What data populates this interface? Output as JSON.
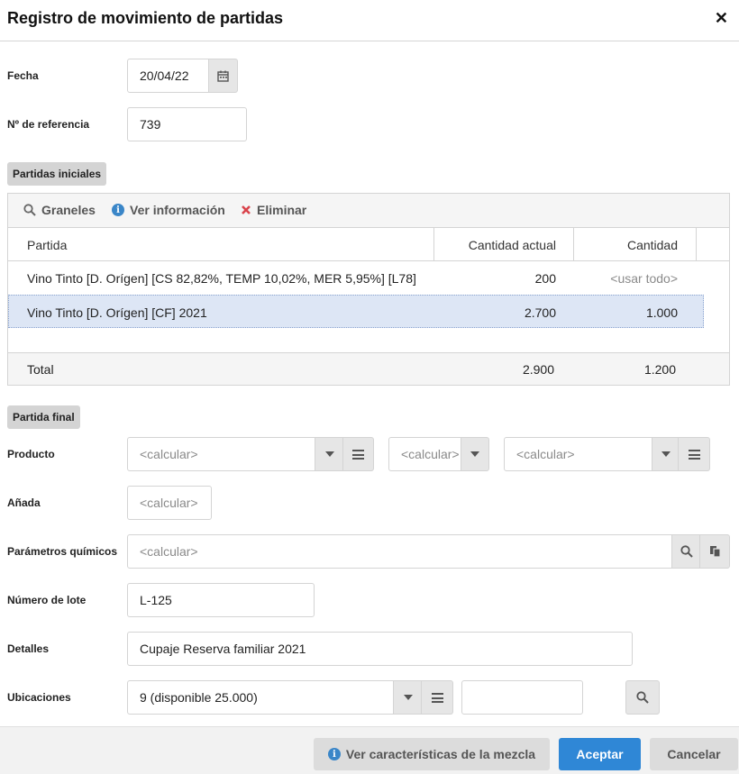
{
  "dialog": {
    "title": "Registro de movimiento de partidas",
    "close_symbol": "✕"
  },
  "fields": {
    "fecha": {
      "label": "Fecha",
      "value": "20/04/22"
    },
    "referencia": {
      "label": "Nº de referencia",
      "value": "739"
    }
  },
  "partidas_iniciales": {
    "section_label": "Partidas iniciales",
    "toolbar": [
      {
        "label": "Graneles",
        "icon": "search-icon"
      },
      {
        "label": "Ver información",
        "icon": "info-icon"
      },
      {
        "label": "Eliminar",
        "icon": "delete-x-icon"
      }
    ],
    "columns": [
      "Partida",
      "Cantidad actual",
      "Cantidad"
    ],
    "rows": [
      {
        "partida": "Vino Tinto [D. Orígen] [CS 82,82%, TEMP 10,02%, MER 5,95%] [L78]",
        "actual": "200",
        "cantidad": "<usar todo>",
        "selected": false
      },
      {
        "partida": "Vino Tinto [D. Orígen] [CF] 2021",
        "actual": "2.700",
        "cantidad": "1.000",
        "selected": true
      }
    ],
    "total": {
      "label": "Total",
      "actual": "2.900",
      "cantidad": "1.200"
    }
  },
  "partida_final": {
    "section_label": "Partida final",
    "producto": {
      "label": "Producto",
      "field1": "<calcular>",
      "field2": "<calcular>",
      "field3": "<calcular>"
    },
    "anada": {
      "label": "Añada",
      "value": "<calcular>"
    },
    "parametros": {
      "label": "Parámetros químicos",
      "value": "<calcular>"
    },
    "lote": {
      "label": "Número de lote",
      "value": "L-125"
    },
    "detalles": {
      "label": "Detalles",
      "value": "Cupaje Reserva familiar 2021"
    },
    "ubicaciones": {
      "label": "Ubicaciones",
      "value": "9 (disponible 25.000)",
      "extra": ""
    }
  },
  "footer": {
    "ver_caracteristicas": "Ver características de la mezcla",
    "aceptar": "Aceptar",
    "cancelar": "Cancelar"
  },
  "colors": {
    "accent": "#2f87d6",
    "selected_row": "#dde6f5",
    "delete_red": "#d9434b",
    "info_blue": "#3a86c8"
  }
}
